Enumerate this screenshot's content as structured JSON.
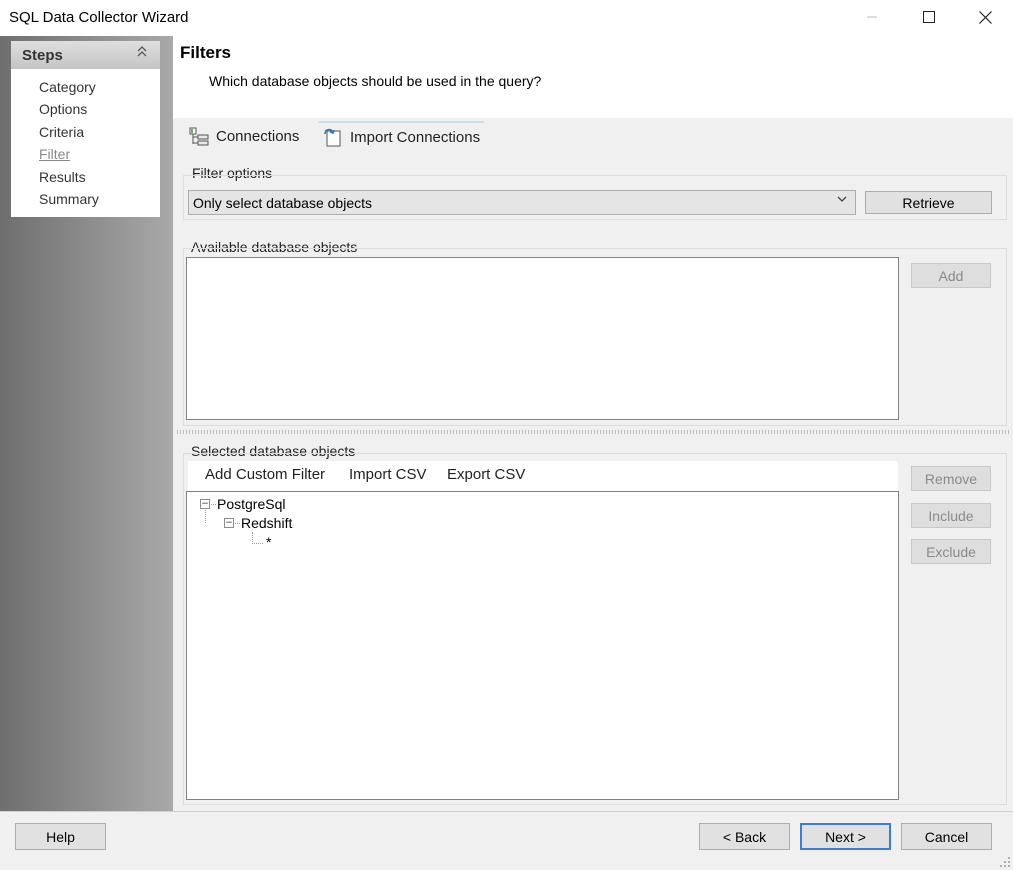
{
  "window": {
    "title": "SQL Data Collector Wizard",
    "minimize_icon": "minimize-icon",
    "maximize_icon": "maximize-icon",
    "close_icon": "close-icon"
  },
  "sidebar": {
    "header": "Steps",
    "collapse_icon": "double-chevron-up-icon",
    "items": [
      {
        "label": "Category",
        "current": false
      },
      {
        "label": "Options",
        "current": false
      },
      {
        "label": "Criteria",
        "current": false
      },
      {
        "label": "Filter",
        "current": true
      },
      {
        "label": "Results",
        "current": false
      },
      {
        "label": "Summary",
        "current": false
      }
    ]
  },
  "header": {
    "title": "Filters",
    "subtitle": "Which database objects should be used in the query?"
  },
  "tabs": [
    {
      "label": "Connections",
      "icon": "connections-icon"
    },
    {
      "label": "Import Connections",
      "icon": "import-icon"
    }
  ],
  "filter_options": {
    "group_label": "Filter options",
    "selected": "Only select database objects",
    "retrieve_label": "Retrieve"
  },
  "available": {
    "group_label": "Available database objects",
    "add_label": "Add"
  },
  "selected": {
    "group_label": "Selected database objects",
    "toolbar": {
      "add_custom_filter": "Add Custom Filter",
      "import_csv": "Import CSV",
      "export_csv": "Export CSV"
    },
    "tree": {
      "root": "PostgreSql",
      "child": "Redshift",
      "leaf": "*"
    },
    "remove_label": "Remove",
    "include_label": "Include",
    "exclude_label": "Exclude"
  },
  "footer": {
    "help": "Help",
    "back": "< Back",
    "next": "Next >",
    "cancel": "Cancel"
  },
  "colors": {
    "sidebar_dark": "#6e6e6e",
    "sidebar_light": "#a9a9a9",
    "default_button_border": "#3c7fd0"
  }
}
